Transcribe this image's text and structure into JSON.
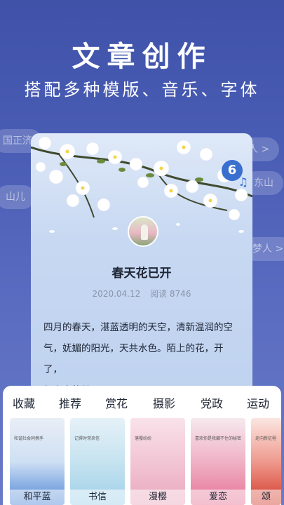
{
  "hero": {
    "title": "文章创作",
    "subtitle": "搭配多种模版、音乐、字体"
  },
  "background_chips": [
    {
      "text": "国正济"
    },
    {
      "text": "人 >"
    },
    {
      "text": "山儿"
    },
    {
      "text": "东山"
    },
    {
      "text": "梦人 >"
    }
  ],
  "article": {
    "title": "春天花已开",
    "date": "2020.04.12",
    "reads_label": "阅读 8746",
    "music_badge": "6",
    "music_note": "♫",
    "body": [
      "四月的春天，湛蓝透明的天空，清新温润的空",
      "气，妩媚的阳光，天共水色。陌上的花，开了，",
      "红尘中的梦，醒了。"
    ]
  },
  "sheet": {
    "tabs": [
      "收藏",
      "推荐",
      "赏花",
      "摄影",
      "党政",
      "运动"
    ],
    "templates": [
      {
        "label": "和平蓝",
        "title": "和谐社会同携手",
        "colors": [
          "#e9eef6",
          "#4f86d6"
        ]
      },
      {
        "label": "书信",
        "title": "记得时常来信",
        "colors": [
          "#e6f1f8",
          "#9fd0e8"
        ]
      },
      {
        "label": "漫樱",
        "title": "落樱纷纷",
        "colors": [
          "#f9e2ea",
          "#e9a7bd"
        ]
      },
      {
        "label": "爱恋",
        "title": "喜欢你是我藏不住的秘密",
        "colors": [
          "#f6e9ee",
          "#e57296"
        ]
      },
      {
        "label": "颂",
        "title": "走向新征程",
        "colors": [
          "#fbe6e1",
          "#d23a2a"
        ]
      }
    ]
  },
  "colors": {
    "background": "#4a5db5",
    "card": "#c7d8f2",
    "accent_blue": "#3a6fd0"
  }
}
